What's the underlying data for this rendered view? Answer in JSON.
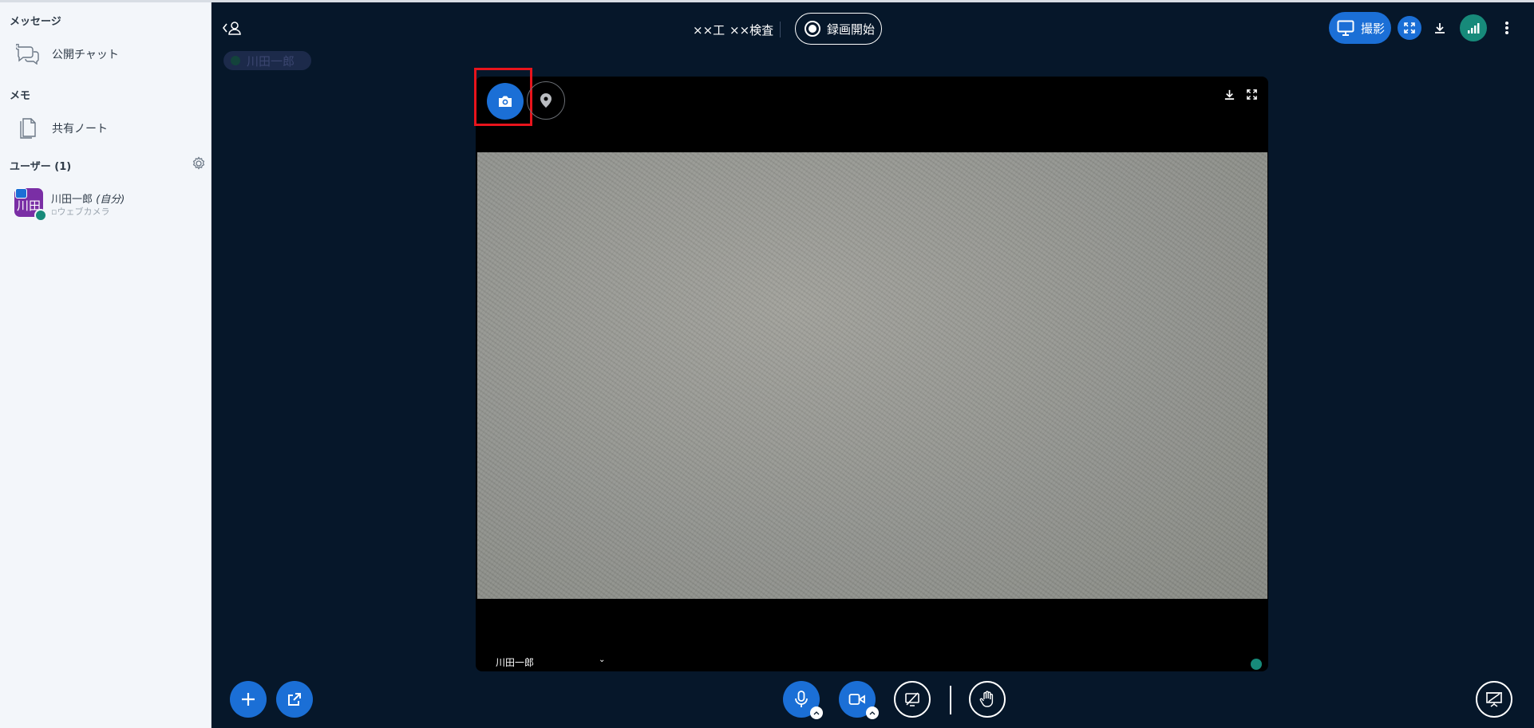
{
  "sidebar": {
    "messages_title": "メッセージ",
    "public_chat": "公開チャット",
    "memo_title": "メモ",
    "shared_notes": "共有ノート",
    "users_title": "ユーザー (1)",
    "user": {
      "avatar_text": "川田",
      "name": "川田一郎",
      "self_tag": "(自分)",
      "subtitle": "ウェブカメラ"
    }
  },
  "header": {
    "nav_item_1": "××工",
    "nav_item_2": "××検査",
    "record_label": "録画開始",
    "shoot_label": "撮影",
    "presenter_chip": "川田一郎"
  },
  "video": {
    "user_name": "川田一郎"
  },
  "icons": {
    "chat": "chat-bubbles-icon",
    "notes": "document-icon",
    "gear": "gear-icon",
    "camera": "camera-icon",
    "location": "location-pin-icon",
    "download": "download-icon",
    "fullscreen": "fullscreen-icon",
    "mic": "microphone-icon",
    "video": "video-camera-icon",
    "screen_share_off": "screen-share-off-icon",
    "hand": "raise-hand-icon",
    "plus": "plus-icon",
    "external": "external-link-icon",
    "presentation": "presentation-icon",
    "signal": "signal-icon",
    "menu": "more-vertical-icon"
  },
  "colors": {
    "primary": "#1b6fd6",
    "background": "#06172a",
    "sidebar": "#f3f6fa",
    "highlight": "#e8141c",
    "signal": "#178a7a"
  }
}
